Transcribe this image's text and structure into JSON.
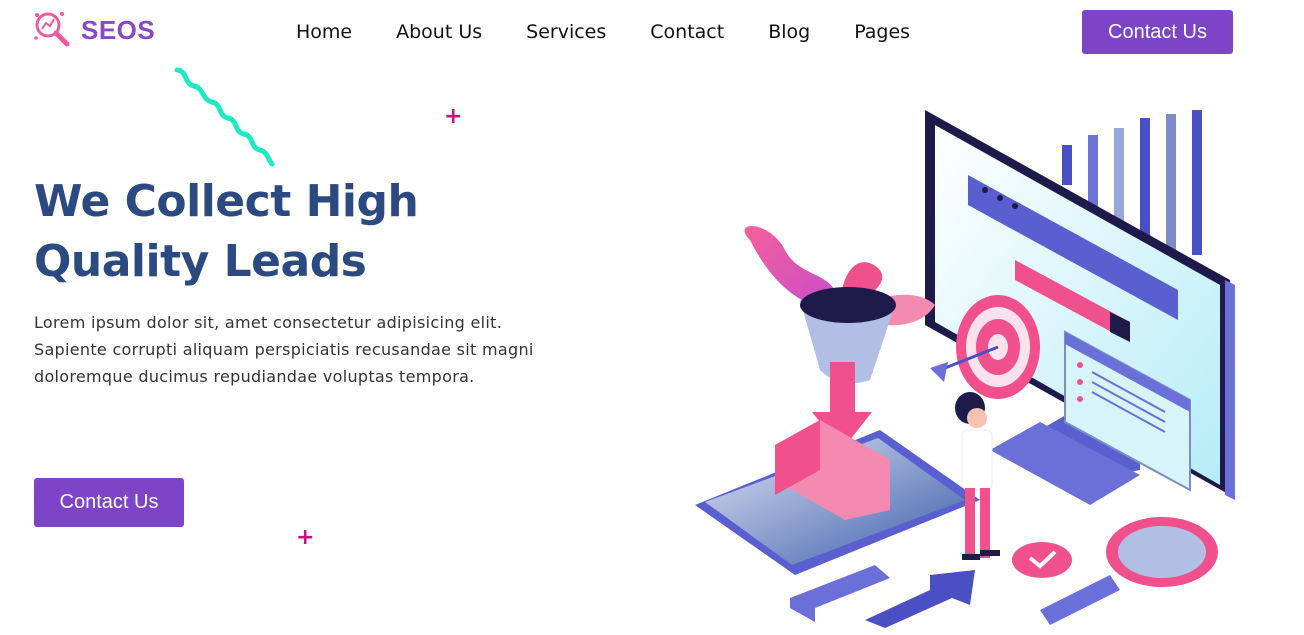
{
  "header": {
    "brand": "SEOS",
    "logo_icon": "magnifier-chart-icon",
    "nav": [
      "Home",
      "About Us",
      "Services",
      "Contact",
      "Blog",
      "Pages"
    ],
    "cta_label": "Contact Us"
  },
  "hero": {
    "title_line1": "We Collect High",
    "title_line2": "Quality Leads",
    "text": "Lorem ipsum dolor sit, amet consectetur adipisicing elit. Sapiente corrupti aliquam perspiciatis recusandae sit magni doloremque ducimus repudiandae voluptas tempora.",
    "cta_label": "Contact Us"
  },
  "colors": {
    "brand_purple": "#7e44c8",
    "heading_navy": "#2b4a82",
    "accent_pink": "#d1107f",
    "squiggle_teal": "#1de9c4"
  },
  "decor": {
    "plus_symbol": "+",
    "illustration": "seo-marketing-isometric-illustration"
  }
}
